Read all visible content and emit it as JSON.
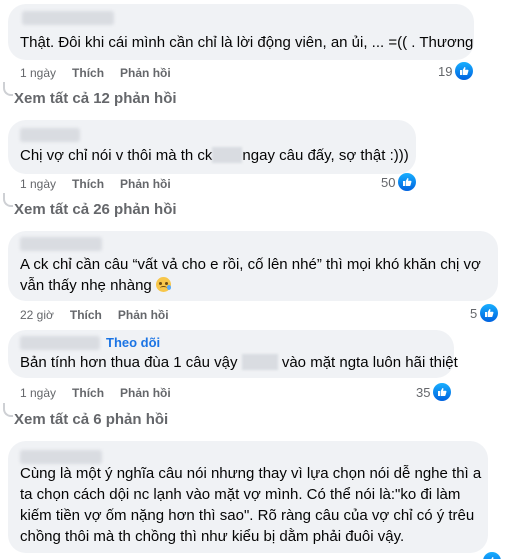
{
  "comments": [
    {
      "text": "Thật. Đôi khi cái mình cần chỉ là lời động viên, an ủi, ... =(( . Thương",
      "time": "1 ngày",
      "like": "Thích",
      "reply": "Phản hồi",
      "reactions": "19"
    },
    {
      "text_before": "Chị vợ chỉ nói v thôi mà th ck",
      "text_after": "ngay câu đấy, sợ thật :)))",
      "time": "1 ngày",
      "like": "Thích",
      "reply": "Phản hồi",
      "reactions": "50"
    },
    {
      "line1": "A ck chỉ cần câu “vất vả cho e rồi, cố lên nhé” thì mọi khó khăn chị vợ",
      "line2": "vẫn thấy nhẹ nhàng",
      "time": "22 giờ",
      "like": "Thích",
      "reply": "Phản hồi",
      "reactions": "5"
    },
    {
      "follow": "Theo dõi",
      "text_before": "Bản tính hơn thua đùa 1 câu vậy",
      "text_after": "vào mặt ngta luôn hãi thiệt",
      "time": "1 ngày",
      "like": "Thích",
      "reply": "Phản hồi",
      "reactions": "35"
    },
    {
      "line1": "Cùng là một ý nghĩa câu nói nhưng thay vì lựa chọn nói dễ nghe thì a",
      "line2": "ta chọn cách dội nc lạnh vào mặt vợ mình. Có thể nói là:\"ko đi làm",
      "line3": "kiếm tiền vợ ốm nặng hơn thì sao\". Rõ ràng câu của vợ chỉ có ý trêu",
      "line4": "chồng thôi mà th chồng thì như kiểu bị dằm phải đuôi vậy."
    }
  ],
  "see_more": [
    "Xem tất cả 12 phản hồi",
    "Xem tất cả 26 phản hồi",
    "Xem tất cả 6 phản hồi"
  ],
  "colors": {
    "bubble": "#f0f2f5",
    "meta_text": "#65676b",
    "link_blue": "#1b74e4",
    "like_blue": "#0866ff"
  },
  "icons": [
    "like-icon",
    "emoji-icon"
  ]
}
